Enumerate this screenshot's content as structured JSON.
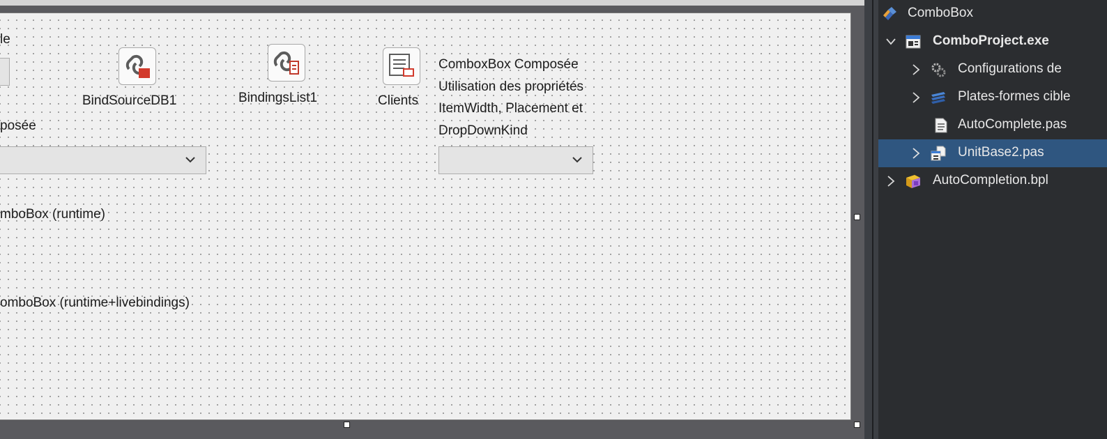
{
  "designer": {
    "labels": {
      "frag_le": "le",
      "frag_posee": "posée",
      "bind_source": "BindSourceDB1",
      "bindings_list": "BindingsList1",
      "clients": "Clients",
      "desc_line1": "ComboxBox Composée",
      "desc_line2": "Utilisation des propriétés",
      "desc_line3": "ItemWidth, Placement et",
      "desc_line4": "DropDownKind",
      "runtime": "mboBox (runtime)",
      "runtime_live": "omboBox (runtime+livebindings)"
    }
  },
  "tree": {
    "items": [
      {
        "label": "ComboBox",
        "icon": "project-group-icon",
        "bold": false,
        "selected": false,
        "expander": "none"
      },
      {
        "label": "ComboProject.exe",
        "icon": "exe-project-icon",
        "bold": true,
        "selected": false,
        "expander": "expanded"
      },
      {
        "label": "Configurations de",
        "icon": "gear-icon",
        "bold": false,
        "selected": false,
        "expander": "collapsed"
      },
      {
        "label": "Plates-formes cible",
        "icon": "platforms-icon",
        "bold": false,
        "selected": false,
        "expander": "collapsed"
      },
      {
        "label": "AutoComplete.pas",
        "icon": "file-icon",
        "bold": false,
        "selected": false,
        "expander": "none"
      },
      {
        "label": "UnitBase2.pas",
        "icon": "unit-form-icon",
        "bold": false,
        "selected": true,
        "expander": "collapsed"
      },
      {
        "label": "AutoCompletion.bpl",
        "icon": "package-icon",
        "bold": false,
        "selected": false,
        "expander": "collapsed"
      }
    ]
  },
  "colors": {
    "selection": "#2f5680",
    "tree_bg": "#2b2d30",
    "form_bg": "#f0f0f0"
  }
}
